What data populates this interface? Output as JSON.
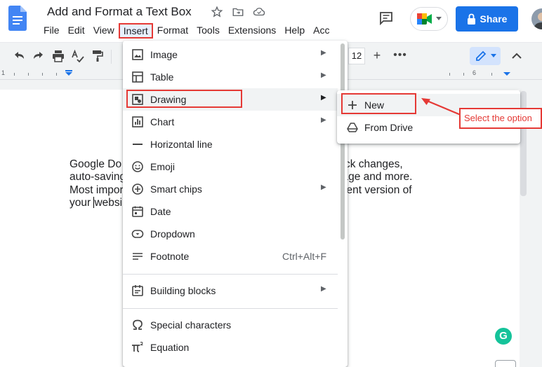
{
  "app": {
    "doc_title": "Add and Format a Text Box",
    "share_label": "Share"
  },
  "menubar": {
    "items": [
      "File",
      "Edit",
      "View",
      "Insert",
      "Format",
      "Tools",
      "Extensions",
      "Help",
      "Acc"
    ]
  },
  "toolbar": {
    "font_size": "12",
    "more_label": "•••"
  },
  "ruler": {
    "numbers": [
      "1",
      "6"
    ]
  },
  "document": {
    "lines": [
      "Google Do                                                  of changes, track changes,",
      "auto-saving                                               porting, file storage and more.",
      "Most impor                                                 ee the most recent version of",
      "your websi"
    ]
  },
  "insert_menu": {
    "items": [
      {
        "label": "Image",
        "icon": "image-icon",
        "has_submenu": true
      },
      {
        "label": "Table",
        "icon": "table-icon",
        "has_submenu": true
      },
      {
        "label": "Drawing",
        "icon": "drawing-icon",
        "has_submenu": true
      },
      {
        "label": "Chart",
        "icon": "chart-icon",
        "has_submenu": true
      },
      {
        "label": "Horizontal line",
        "icon": "horizontal-line-icon",
        "has_submenu": false
      },
      {
        "label": "Emoji",
        "icon": "emoji-icon",
        "has_submenu": false
      },
      {
        "label": "Smart chips",
        "icon": "smart-chips-icon",
        "has_submenu": true
      },
      {
        "label": "Date",
        "icon": "date-icon",
        "has_submenu": false
      },
      {
        "label": "Dropdown",
        "icon": "dropdown-icon",
        "has_submenu": false
      },
      {
        "label": "Footnote",
        "icon": "footnote-icon",
        "has_submenu": false,
        "shortcut": "Ctrl+Alt+F"
      },
      {
        "label": "Building blocks",
        "icon": "building-blocks-icon",
        "has_submenu": true
      },
      {
        "label": "Special characters",
        "icon": "omega-icon",
        "has_submenu": false
      },
      {
        "label": "Equation",
        "icon": "pi-icon",
        "has_submenu": false
      }
    ]
  },
  "drawing_submenu": {
    "items": [
      {
        "label": "New",
        "icon": "plus-icon"
      },
      {
        "label": "From Drive",
        "icon": "drive-icon"
      }
    ]
  },
  "annotation": {
    "callout_text": "Select the option",
    "color": "#e53935"
  },
  "colors": {
    "accent": "#1a73e8",
    "annotation_red": "#e53935",
    "grammarly": "#15c39a"
  }
}
